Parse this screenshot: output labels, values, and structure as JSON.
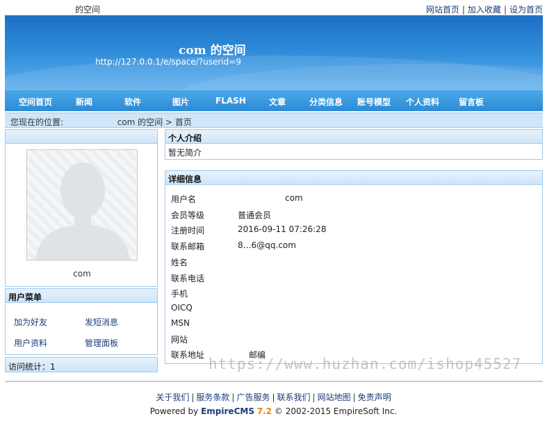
{
  "top": {
    "site_title": "的空间",
    "links": [
      "网站首页",
      "加入收藏",
      "设为首页"
    ],
    "sep": "|"
  },
  "banner": {
    "space_name": "com 的空间",
    "url": "http://127.0.0.1/e/space/?userid=9"
  },
  "nav": [
    "空间首页",
    "新闻",
    "软件",
    "图片",
    "FLASH",
    "文章",
    "分类信息",
    "账号模型",
    "个人资料",
    "留言板"
  ],
  "breadcrumb": {
    "prefix": "您现在的位置:",
    "space_link": "com 的空间",
    "arrow": ">",
    "current": "首页"
  },
  "profile": {
    "username": "com"
  },
  "user_menu": {
    "title": "用户菜单",
    "items": [
      "加为好友",
      "发短消息",
      "用户资料",
      "管理面板"
    ]
  },
  "visits": "访问统计：1",
  "intro": {
    "title": "个人介绍",
    "text": "暂无简介"
  },
  "details": {
    "title": "详细信息",
    "rows": [
      {
        "label": "用户名",
        "value": "com"
      },
      {
        "label": "会员等级",
        "value": "普通会员"
      },
      {
        "label": "注册时间",
        "value": "2016-09-11 07:26:28"
      },
      {
        "label": "联系邮箱",
        "value": "8…6@qq.com"
      },
      {
        "label": "姓名",
        "value": ""
      },
      {
        "label": "联系电话",
        "value": ""
      },
      {
        "label": "手机",
        "value": ""
      },
      {
        "label": "OICQ",
        "value": ""
      },
      {
        "label": "MSN",
        "value": ""
      },
      {
        "label": "网站",
        "value": ""
      },
      {
        "label": "联系地址",
        "value": "邮编"
      }
    ]
  },
  "footer": {
    "links": [
      "关于我们",
      "服务条款",
      "广告服务",
      "联系我们",
      "网站地图",
      "免责声明"
    ],
    "powered_prefix": "Powered by",
    "brand": "EmpireCMS",
    "version": "7.2",
    "copyright": "© 2002-2015 EmpireSoft Inc."
  },
  "watermark": "https://www.huzhan.com/ishop45527",
  "colors": {
    "nav_bg": "#2d8bd6",
    "panel_border": "#9ccbef",
    "link": "#1a3c7a"
  }
}
